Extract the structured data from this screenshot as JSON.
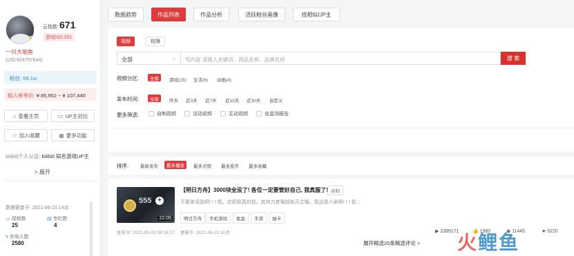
{
  "profile": {
    "fans_label": "云指数:",
    "fans_value": "671",
    "rank_tag": "游戏NO.281",
    "username": "一只大咱鱼",
    "uid": "(UID:624757644)",
    "followers": "粉丝: 58.1w",
    "price_label": "植入参考价:",
    "price_value": "¥ 85,952 ~ ¥ 107,440",
    "buttons": {
      "homepage": "查看主页",
      "compare": "UP主对比",
      "favorite": "加入收藏",
      "more": "更多功能"
    },
    "cert_label": "bilibili个人认证:",
    "cert_value": "bilibili 知名游戏UP主",
    "expand": "> 展开",
    "update_time": "数据更新于: 2021-06-23 14点",
    "stats": {
      "videos_label": "视频数",
      "videos_value": "25",
      "articles_label": "专栏数",
      "articles_value": "4",
      "charge_label": "充电人数",
      "charge_value": "2580"
    }
  },
  "tabs": [
    {
      "label": "数据趋势"
    },
    {
      "label": "作品列表"
    },
    {
      "label": "作品分析"
    },
    {
      "label": "活跃粉丝画像"
    },
    {
      "label": "找相似UP主"
    }
  ],
  "filters": {
    "type_video": "视频",
    "type_album": "相簿",
    "select_value": "全部",
    "search_placeholder": "写内容 请输入关键词、商品名称、品牌名称",
    "search_button": "搜 索",
    "zone_label": "视频分区:",
    "zones": [
      "全部",
      "游戏(15)",
      "生活(6)",
      "动画(4)"
    ],
    "time_label": "发布时间:",
    "times": [
      "全部",
      "昨天",
      "近3天",
      "近7天",
      "近15天",
      "近30天",
      "自定义"
    ],
    "more_label": "更多筛选:",
    "more_options": [
      "自制视频",
      "活动视频",
      "互动视频",
      "含监测报告"
    ]
  },
  "sort": {
    "label": "排序:",
    "options": [
      "最新发布",
      "最多播放",
      "最多点赞",
      "最多投币",
      "最多收藏"
    ]
  },
  "video": {
    "thumb_num": "555",
    "duration": "22:05",
    "title": "【明日方舟】3000块全没了! 各位一定要管好自己, 我真服了!",
    "self_tag": "自制",
    "desc": "不要笑话我啊! ! ! 我。欢肥我真的我。其他刀者嘱部和天文嘱。我这是人刷啊! ! ! 我...",
    "tags": [
      "明日方舟",
      "手机游戏",
      "氪金",
      "手游",
      "抽卡"
    ],
    "publish": "发布于: 2021-05-02 08:16:27",
    "updated": "更新于: 2021-06-22 10点",
    "stat_play": "2389171",
    "stat_like": "1980",
    "stat_coin": "11445",
    "stat_fav": "5220",
    "more_comments": "展开精选20条精选评论 >"
  },
  "watermark": {
    "left": "火",
    "right": "鲤鱼"
  }
}
